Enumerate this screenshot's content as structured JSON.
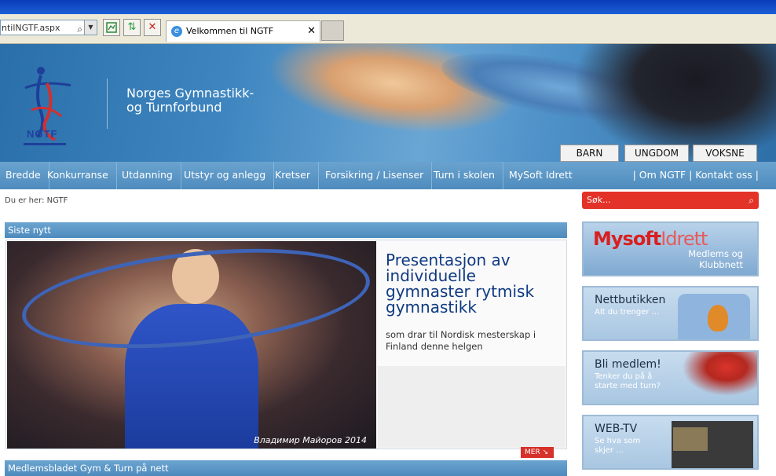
{
  "browser": {
    "address": "ntilNGTF.aspx",
    "tab_title": "Velkommen til NGTF"
  },
  "header": {
    "logo_text": "NGTF",
    "org_line1": "Norges Gymnastikk-",
    "org_line2": "og Turnforbund",
    "audience": [
      "BARN",
      "UNGDOM",
      "VOKSNE"
    ]
  },
  "nav": {
    "items": [
      "Bredde",
      "Konkurranse",
      "Utdanning",
      "Utstyr og anlegg",
      "Kretser",
      "Forsikring / Lisenser",
      "Turn i skolen",
      "MySoft Idrett"
    ],
    "utility": "| Om NGTF | Kontakt oss |"
  },
  "breadcrumb": "Du er her: NGTF",
  "news": {
    "section_title": "Siste nytt",
    "headline": "Presentasjon av individuelle gymnaster rytmisk gymnastikk",
    "teaser": "som drar til Nordisk mesterskap i Finland denne helgen",
    "photo_credit": "Владимир Майоров 2014",
    "more_label": "MER"
  },
  "next_section": "Medlemsbladet Gym & Turn på nett",
  "sidebar": {
    "search_placeholder": "Søk...",
    "mysoft_red": "Mysoft",
    "mysoft_light": "Idrett",
    "mysoft_sub1": "Medlems og",
    "mysoft_sub2": "Klubbnett",
    "shop_title": "Nettbutikken",
    "shop_sub": "Alt du trenger ...",
    "member_title": "Bli medlem!",
    "member_sub1": "Tenker du på å",
    "member_sub2": "starte med turn?",
    "webtv_title": "WEB-TV",
    "webtv_sub1": "Se hva som",
    "webtv_sub2": "skjer ..."
  }
}
